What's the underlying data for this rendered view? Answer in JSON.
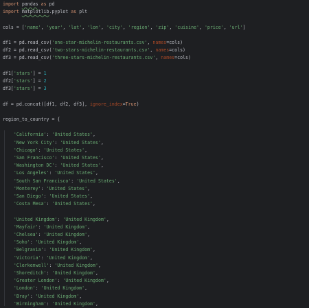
{
  "editor": {
    "lines": [
      {
        "row": 0,
        "tokens": [
          {
            "t": "import",
            "k": "kw"
          },
          {
            "t": " "
          },
          {
            "t": "pandas",
            "k": "mod"
          },
          {
            "t": " "
          },
          {
            "t": "as",
            "k": "kw"
          },
          {
            "t": " pd"
          }
        ]
      },
      {
        "row": 1,
        "tokens": [
          {
            "t": "import",
            "k": "kw"
          },
          {
            "t": " "
          },
          {
            "t": "matplotlib",
            "k": "mod"
          },
          {
            "t": ".pyplot "
          },
          {
            "t": "as",
            "k": "kw"
          },
          {
            "t": " plt"
          }
        ]
      },
      {
        "row": 3,
        "tokens": [
          {
            "t": "cols = ["
          },
          {
            "t": "'name'",
            "k": "str"
          },
          {
            "t": ", "
          },
          {
            "t": "'year'",
            "k": "str"
          },
          {
            "t": ", "
          },
          {
            "t": "'lat'",
            "k": "str"
          },
          {
            "t": ", "
          },
          {
            "t": "'lon'",
            "k": "str"
          },
          {
            "t": ", "
          },
          {
            "t": "'city'",
            "k": "str"
          },
          {
            "t": ", "
          },
          {
            "t": "'region'",
            "k": "str"
          },
          {
            "t": ", "
          },
          {
            "t": "'zip'",
            "k": "str"
          },
          {
            "t": ", "
          },
          {
            "t": "'cuisine'",
            "k": "str"
          },
          {
            "t": ", "
          },
          {
            "t": "'price'",
            "k": "str"
          },
          {
            "t": ", "
          },
          {
            "t": "'url'",
            "k": "str"
          },
          {
            "t": "]"
          }
        ]
      },
      {
        "row": 5,
        "tokens": [
          {
            "t": "df1 = pd.read_csv("
          },
          {
            "t": "'one-star-michelin-restaurants.csv'",
            "k": "str"
          },
          {
            "t": ", "
          },
          {
            "t": "names",
            "k": "param"
          },
          {
            "t": "=cols)"
          }
        ]
      },
      {
        "row": 6,
        "tokens": [
          {
            "t": "df2 = pd.read_csv("
          },
          {
            "t": "'two-stars-michelin-restaurants.csv'",
            "k": "str"
          },
          {
            "t": ", "
          },
          {
            "t": "names",
            "k": "param"
          },
          {
            "t": "=cols)"
          }
        ]
      },
      {
        "row": 7,
        "tokens": [
          {
            "t": "df3 = pd.read_csv("
          },
          {
            "t": "'three-stars-michelin-restaurants.csv'",
            "k": "str"
          },
          {
            "t": ", "
          },
          {
            "t": "names",
            "k": "param"
          },
          {
            "t": "=cols)"
          }
        ]
      },
      {
        "row": 9,
        "tokens": [
          {
            "t": "df1["
          },
          {
            "t": "'stars'",
            "k": "str"
          },
          {
            "t": "] = "
          },
          {
            "t": "1",
            "k": "num"
          }
        ]
      },
      {
        "row": 10,
        "tokens": [
          {
            "t": "df2["
          },
          {
            "t": "'stars'",
            "k": "str"
          },
          {
            "t": "] = "
          },
          {
            "t": "2",
            "k": "num"
          }
        ]
      },
      {
        "row": 11,
        "tokens": [
          {
            "t": "df3["
          },
          {
            "t": "'stars'",
            "k": "str"
          },
          {
            "t": "] = "
          },
          {
            "t": "3",
            "k": "num"
          }
        ]
      },
      {
        "row": 13,
        "tokens": [
          {
            "t": "df = pd.concat([df1, df2, df3], "
          },
          {
            "t": "ignore_index",
            "k": "param"
          },
          {
            "t": "="
          },
          {
            "t": "True",
            "k": "const"
          },
          {
            "t": ")"
          }
        ]
      },
      {
        "row": 15,
        "tokens": [
          {
            "t": "region_to_country = {"
          }
        ]
      },
      {
        "row": 17,
        "tokens": [
          {
            "t": "    "
          },
          {
            "t": "'California'",
            "k": "str"
          },
          {
            "t": ": "
          },
          {
            "t": "'United States'",
            "k": "str"
          },
          {
            "t": ","
          }
        ]
      },
      {
        "row": 18,
        "tokens": [
          {
            "t": "    "
          },
          {
            "t": "'New York City'",
            "k": "str"
          },
          {
            "t": ": "
          },
          {
            "t": "'United States'",
            "k": "str"
          },
          {
            "t": ","
          }
        ]
      },
      {
        "row": 19,
        "tokens": [
          {
            "t": "    "
          },
          {
            "t": "'Chicago'",
            "k": "str"
          },
          {
            "t": ": "
          },
          {
            "t": "'United States'",
            "k": "str"
          },
          {
            "t": ","
          }
        ]
      },
      {
        "row": 20,
        "tokens": [
          {
            "t": "    "
          },
          {
            "t": "'San Francisco'",
            "k": "str"
          },
          {
            "t": ": "
          },
          {
            "t": "'United States'",
            "k": "str"
          },
          {
            "t": ","
          }
        ]
      },
      {
        "row": 21,
        "tokens": [
          {
            "t": "    "
          },
          {
            "t": "'Washington DC'",
            "k": "str"
          },
          {
            "t": ": "
          },
          {
            "t": "'United States'",
            "k": "str"
          },
          {
            "t": ","
          }
        ]
      },
      {
        "row": 22,
        "tokens": [
          {
            "t": "    "
          },
          {
            "t": "'Los Angeles'",
            "k": "str"
          },
          {
            "t": ": "
          },
          {
            "t": "'United States'",
            "k": "str"
          },
          {
            "t": ","
          }
        ]
      },
      {
        "row": 23,
        "tokens": [
          {
            "t": "    "
          },
          {
            "t": "'South San Francisco'",
            "k": "str"
          },
          {
            "t": ": "
          },
          {
            "t": "'United States'",
            "k": "str"
          },
          {
            "t": ","
          }
        ]
      },
      {
        "row": 24,
        "tokens": [
          {
            "t": "    "
          },
          {
            "t": "'Monterey'",
            "k": "str"
          },
          {
            "t": ": "
          },
          {
            "t": "'United States'",
            "k": "str"
          },
          {
            "t": ","
          }
        ]
      },
      {
        "row": 25,
        "tokens": [
          {
            "t": "    "
          },
          {
            "t": "'San Diego'",
            "k": "str"
          },
          {
            "t": ": "
          },
          {
            "t": "'United States'",
            "k": "str"
          },
          {
            "t": ","
          }
        ]
      },
      {
        "row": 26,
        "tokens": [
          {
            "t": "    "
          },
          {
            "t": "'Costa Mesa'",
            "k": "str"
          },
          {
            "t": ": "
          },
          {
            "t": "'United States'",
            "k": "str"
          },
          {
            "t": ","
          }
        ]
      },
      {
        "row": 28,
        "tokens": [
          {
            "t": "    "
          },
          {
            "t": "'United Kingdom'",
            "k": "str"
          },
          {
            "t": ": "
          },
          {
            "t": "'United Kingdom'",
            "k": "str"
          },
          {
            "t": ","
          }
        ]
      },
      {
        "row": 29,
        "tokens": [
          {
            "t": "    "
          },
          {
            "t": "'Mayfair'",
            "k": "str"
          },
          {
            "t": ": "
          },
          {
            "t": "'United Kingdom'",
            "k": "str"
          },
          {
            "t": ","
          }
        ]
      },
      {
        "row": 30,
        "tokens": [
          {
            "t": "    "
          },
          {
            "t": "'Chelsea'",
            "k": "str"
          },
          {
            "t": ": "
          },
          {
            "t": "'United Kingdom'",
            "k": "str"
          },
          {
            "t": ","
          }
        ]
      },
      {
        "row": 31,
        "tokens": [
          {
            "t": "    "
          },
          {
            "t": "'Soho'",
            "k": "str"
          },
          {
            "t": ": "
          },
          {
            "t": "'United Kingdom'",
            "k": "str"
          },
          {
            "t": ","
          }
        ]
      },
      {
        "row": 32,
        "tokens": [
          {
            "t": "    "
          },
          {
            "t": "'Belgravia'",
            "k": "str"
          },
          {
            "t": ": "
          },
          {
            "t": "'United Kingdom'",
            "k": "str"
          },
          {
            "t": ","
          }
        ]
      },
      {
        "row": 33,
        "tokens": [
          {
            "t": "    "
          },
          {
            "t": "'Victoria'",
            "k": "str"
          },
          {
            "t": ": "
          },
          {
            "t": "'United Kingdom'",
            "k": "str"
          },
          {
            "t": ","
          }
        ]
      },
      {
        "row": 34,
        "tokens": [
          {
            "t": "    "
          },
          {
            "t": "'Clerkenwell'",
            "k": "str"
          },
          {
            "t": ": "
          },
          {
            "t": "'United Kingdom'",
            "k": "str"
          },
          {
            "t": ","
          }
        ]
      },
      {
        "row": 35,
        "tokens": [
          {
            "t": "    "
          },
          {
            "t": "'Shoreditch'",
            "k": "str"
          },
          {
            "t": ": "
          },
          {
            "t": "'United Kingdom'",
            "k": "str"
          },
          {
            "t": ","
          }
        ]
      },
      {
        "row": 36,
        "tokens": [
          {
            "t": "    "
          },
          {
            "t": "'Greater London'",
            "k": "str"
          },
          {
            "t": ": "
          },
          {
            "t": "'United Kingdom'",
            "k": "str"
          },
          {
            "t": ","
          }
        ]
      },
      {
        "row": 37,
        "tokens": [
          {
            "t": "    "
          },
          {
            "t": "'London'",
            "k": "str"
          },
          {
            "t": ": "
          },
          {
            "t": "'United Kingdom'",
            "k": "str"
          },
          {
            "t": ","
          }
        ]
      },
      {
        "row": 38,
        "tokens": [
          {
            "t": "    "
          },
          {
            "t": "'Bray'",
            "k": "str"
          },
          {
            "t": ": "
          },
          {
            "t": "'United Kingdom'",
            "k": "str"
          },
          {
            "t": ","
          }
        ]
      },
      {
        "row": 39,
        "tokens": [
          {
            "t": "    "
          },
          {
            "t": "'Birmingham'",
            "k": "str"
          },
          {
            "t": ": "
          },
          {
            "t": "'United Kingdom'",
            "k": "str"
          },
          {
            "t": ","
          }
        ]
      }
    ]
  },
  "colors": {
    "background": "#1e1f22",
    "default_text": "#bcbec4",
    "keyword": "#cf8e6d",
    "string": "#6aab73",
    "named_argument": "#aa4926",
    "number": "#2aacb8"
  }
}
